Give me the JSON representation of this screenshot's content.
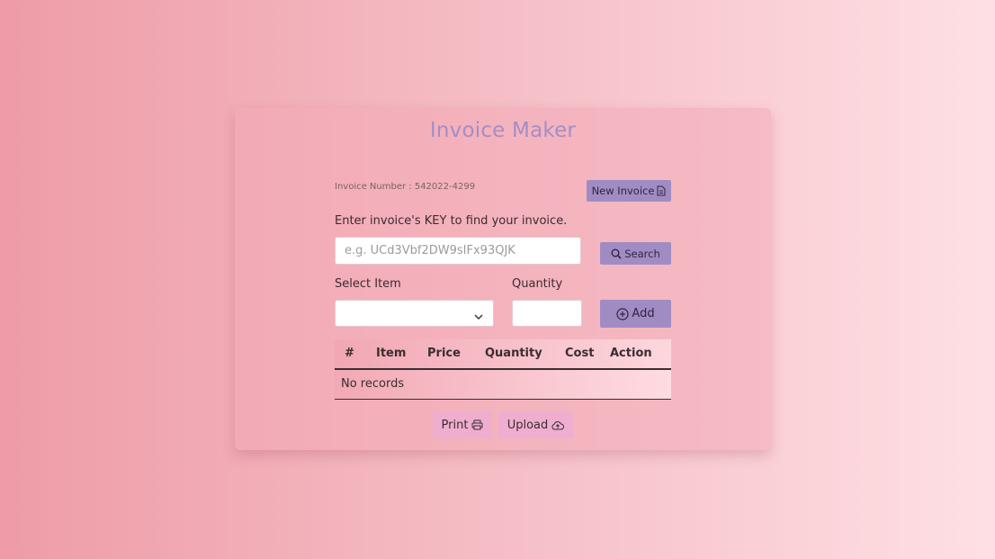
{
  "app": {
    "title": "Invoice Maker"
  },
  "invoice": {
    "number_text": "Invoice Number : 542022-4299",
    "new_invoice_label": "New Invoice"
  },
  "search": {
    "hint": "Enter invoice's KEY to find your invoice.",
    "placeholder": "e.g. UCd3Vbf2DW9sIFx93QJK",
    "value": "",
    "button_label": "Search"
  },
  "form": {
    "select_label": "Select Item",
    "selected_item": "",
    "quantity_label": "Quantity",
    "quantity_value": "",
    "add_label": "Add"
  },
  "table": {
    "columns": [
      "#",
      "Item",
      "Price",
      "Quantity",
      "Cost",
      "Action"
    ],
    "empty_text": "No records"
  },
  "actions": {
    "print_label": "Print",
    "upload_label": "Upload"
  },
  "icons": {
    "new_invoice": "document-icon",
    "search": "magnifier-icon",
    "add": "plus-circle-icon",
    "select": "chevron-down-icon",
    "print": "printer-icon",
    "upload": "cloud-upload-icon"
  },
  "colors": {
    "title": "#a48ec4",
    "primary_button": "#a08cc3",
    "secondary_button": "#efaed0"
  }
}
